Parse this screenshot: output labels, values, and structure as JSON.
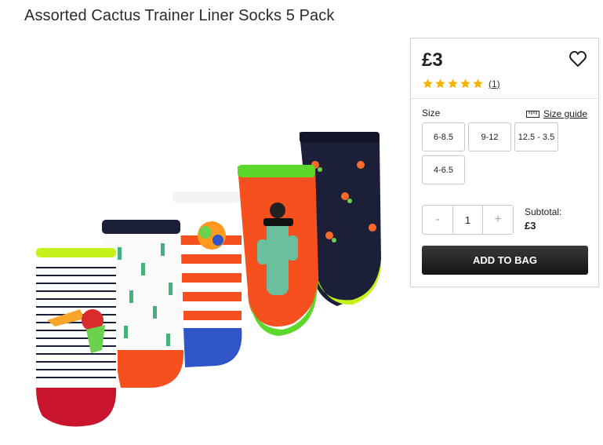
{
  "product": {
    "title": "Assorted Cactus Trainer Liner Socks 5 Pack",
    "image_icon": "socks-product-image"
  },
  "buybox": {
    "price": "£3",
    "rating": {
      "stars": 5,
      "max": 5,
      "reviews_label": "(1)"
    },
    "size_label": "Size",
    "size_guide_label": "Size guide",
    "sizes": [
      "6-8.5",
      "9-12",
      "12.5 - 3.5",
      "4-6.5"
    ],
    "quantity": {
      "minus": "-",
      "value": "1",
      "plus": "+"
    },
    "subtotal_label": "Subtotal:",
    "subtotal_value": "£3",
    "add_to_bag": "ADD TO BAG"
  },
  "colors": {
    "star": "#f5b400",
    "button_dark": "#1f1f1f",
    "border": "#c9c9c9"
  }
}
